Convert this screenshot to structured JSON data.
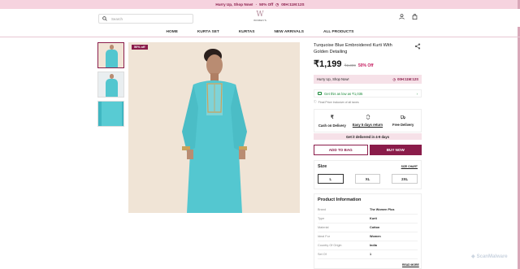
{
  "announcement": {
    "part1": "Hurry Up, Shop Now!",
    "sep": "·",
    "part2": "50% Off",
    "timer": "00H:11M:12S"
  },
  "header": {
    "search_placeholder": "Search",
    "logo_mark": "W",
    "logo_text": "WOMEN'S"
  },
  "nav": {
    "items": [
      "HOME",
      "KURTA SET",
      "KURTAS",
      "NEW ARRIVALS",
      "ALL PRODUCTS"
    ]
  },
  "gallery": {
    "badge": "50% off"
  },
  "product": {
    "title": "Turquoise Blue Embroidered Kurti With Golden Detailing",
    "price": "₹1,199",
    "mrp": "₹2,399",
    "discount": "50% Off",
    "hurry_text": "Hurry Up, Shop Now!",
    "hurry_timer": "00H:11M:12S",
    "offer_text": "Get this as low as ₹1,035",
    "incl_text": "Final Price Inclusive of all taxes",
    "features": [
      {
        "label": "Cash on Delivery",
        "icon": "rupee-icon"
      },
      {
        "label": "Easy 5 days return",
        "icon": "return-icon"
      },
      {
        "label": "Free Delivery",
        "icon": "truck-icon"
      }
    ],
    "delivery_text": "Get it delivered in 4-9 days",
    "add_to_bag": "ADD TO BAG",
    "buy_now": "BUY NOW"
  },
  "size": {
    "heading": "Size",
    "chart_link": "SIZE CHART",
    "options": [
      "L",
      "XL",
      "2XL"
    ],
    "selected": "L"
  },
  "info": {
    "heading": "Product Information",
    "rows": [
      {
        "k": "Brand",
        "v": "The Women Plus"
      },
      {
        "k": "Type",
        "v": "Kurti"
      },
      {
        "k": "Material",
        "v": "Cotton"
      },
      {
        "k": "Ideal For",
        "v": "Women"
      },
      {
        "k": "Country Of Origin",
        "v": "India"
      },
      {
        "k": "Set Of",
        "v": "1"
      }
    ],
    "read_more": "READ MORE"
  },
  "watermark": "ScanMalware",
  "colors": {
    "brand": "#8a1c4a",
    "kurta": "#52c6cf",
    "announcement_bg": "#f6d3df"
  }
}
